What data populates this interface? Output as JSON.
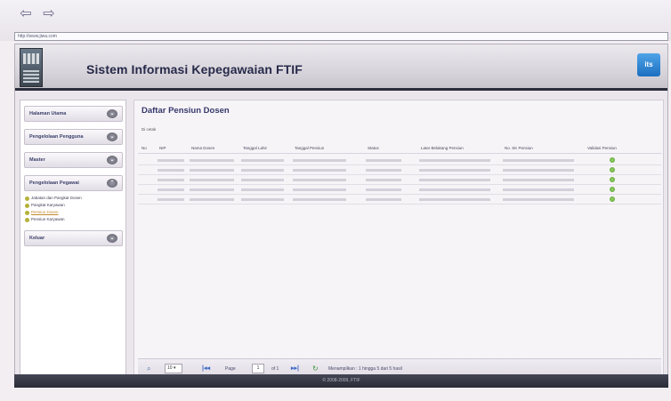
{
  "browser": {
    "back_icon": "left-arrow",
    "forward_icon": "right-arrow",
    "url": "http://www.jiwa.com"
  },
  "header": {
    "title": "Sistem Informasi Kepegawaian FTIF",
    "badge": "its"
  },
  "sidebar": {
    "items": [
      {
        "label": "Halaman Utama"
      },
      {
        "label": "Pengelolaan Pengguna"
      },
      {
        "label": "Master"
      },
      {
        "label": "Pengelolaan Pegawai"
      },
      {
        "label": "Keluar"
      }
    ],
    "submenu": [
      {
        "label": "Jabatan dan Pangkat Dosen"
      },
      {
        "label": "Pangkat Karyawan"
      },
      {
        "label": "Pensiun Dosen"
      },
      {
        "label": "Pensiun Karyawan"
      }
    ]
  },
  "main": {
    "title": "Daftar Pensiun Dosen",
    "print_label": "Di cetak",
    "columns": [
      "No",
      "NIP",
      "Nama Dosen",
      "Tanggal Lahir",
      "Tanggal Pensiun",
      "Status",
      "Latar Belakang Pensiun",
      "No. SK Pensiun",
      "Validasi Pensiun"
    ],
    "row_count": 5
  },
  "pager": {
    "page_size": "10",
    "page_label": "Page",
    "page_value": "1",
    "of_label": "of 1",
    "status": "Menampilkan : 1 hingga 5 dari 5 hasil"
  },
  "footer": {
    "text": "© 2008-2009, FTIF"
  }
}
